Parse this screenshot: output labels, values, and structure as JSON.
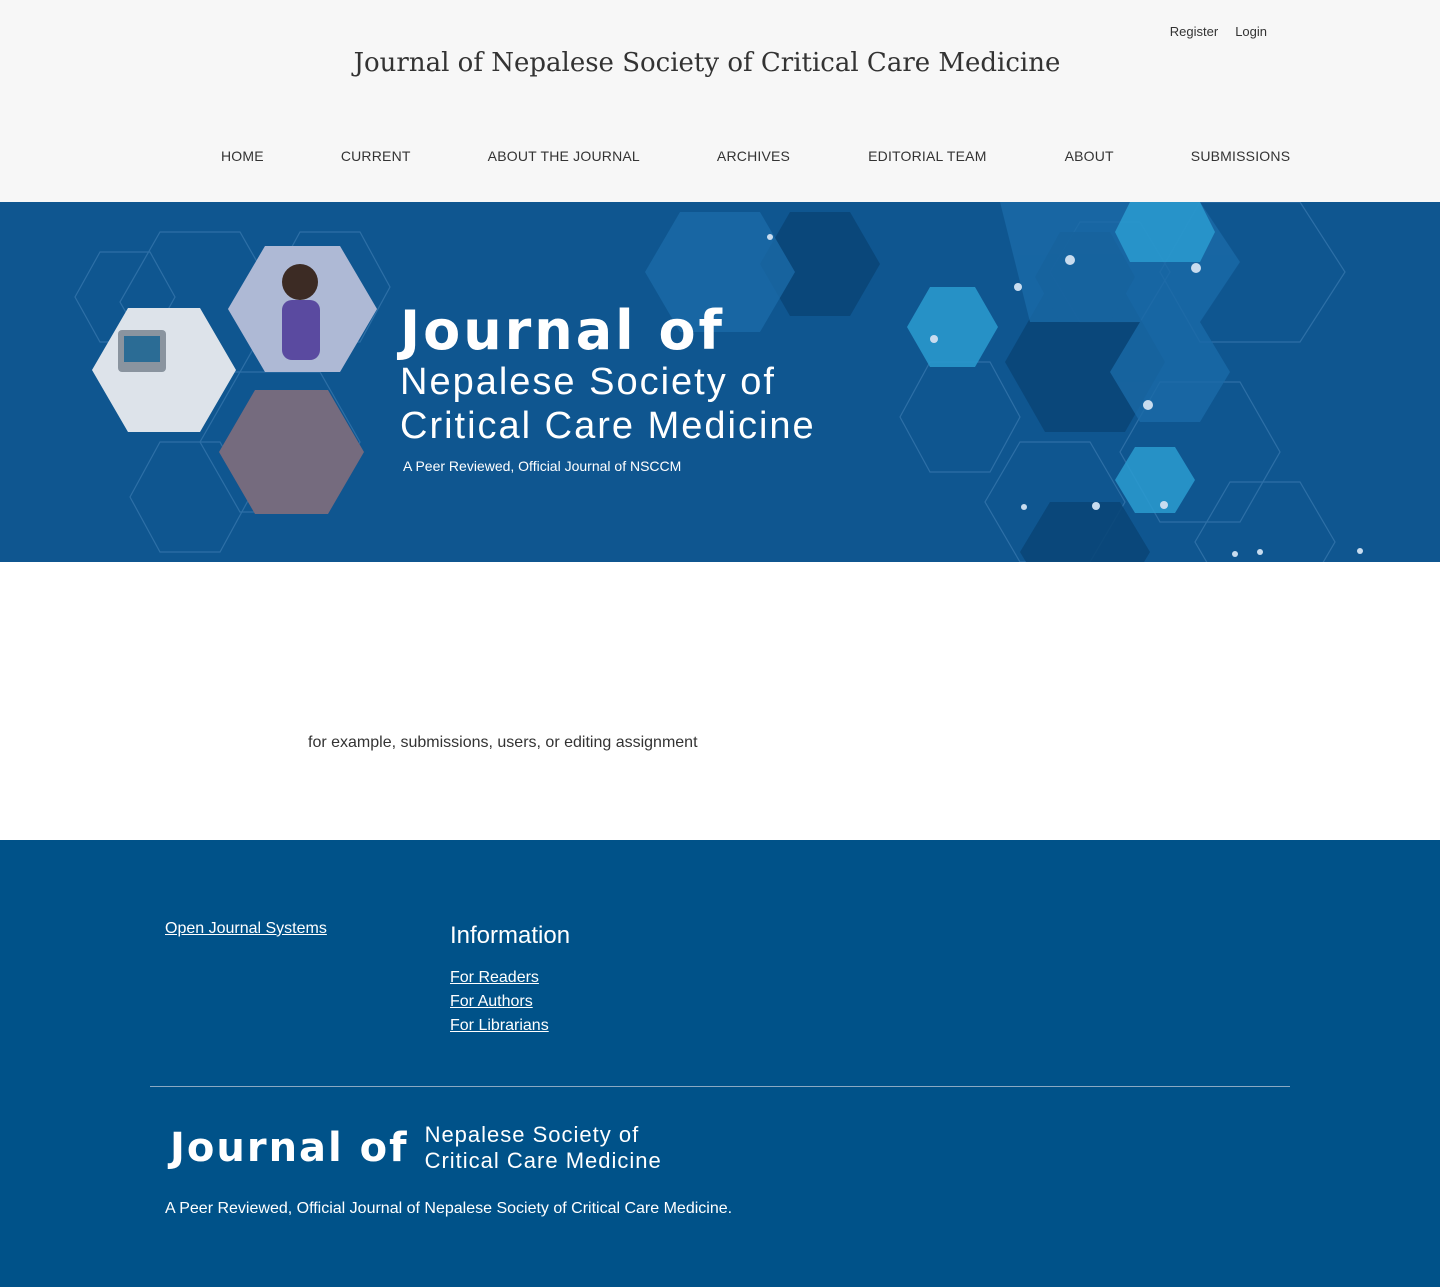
{
  "user_nav": {
    "register": "Register",
    "login": "Login"
  },
  "site_title": "Journal of Nepalese Society of Critical Care Medicine",
  "nav": [
    "HOME",
    "CURRENT",
    "ABOUT THE JOURNAL",
    "ARCHIVES",
    "EDITORIAL TEAM",
    "ABOUT",
    "SUBMISSIONS"
  ],
  "banner": {
    "line1": "Journal of",
    "line2": "Nepalese Society of",
    "line3": "Critical Care Medicine",
    "tagline": "A Peer Reviewed, Official Journal of NSCCM"
  },
  "content": {
    "text": "for example, submissions, users, or editing assignment"
  },
  "footer": {
    "ojs_link": "Open Journal Systems",
    "info_title": "Information",
    "info_links": [
      "For Readers",
      "For Authors",
      "For Librarians"
    ],
    "logo_bold": "Journal of",
    "logo_line1": "Nepalese Society of",
    "logo_line2": "Critical Care Medicine",
    "description": "A Peer Reviewed, Official Journal of Nepalese Society of Critical Care Medicine."
  },
  "colors": {
    "header_bg": "#f7f7f7",
    "banner_bg": "#0f5690",
    "footer_bg": "#005289"
  }
}
